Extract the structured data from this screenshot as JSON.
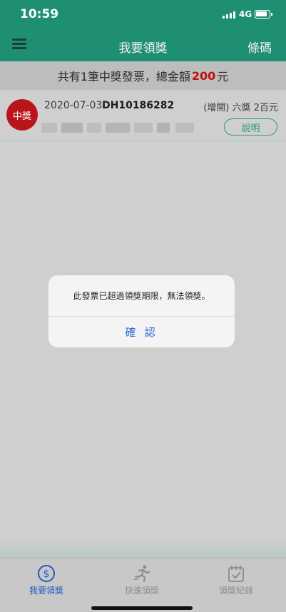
{
  "status_bar": {
    "time": "10:59",
    "network": "4G"
  },
  "header": {
    "title": "我要領獎",
    "right_action": "條碼"
  },
  "summary": {
    "prefix": "共有1筆中獎發票，總金額",
    "amount": "200",
    "suffix": "元"
  },
  "invoice": {
    "badge": "中獎",
    "date": "2020-07-03",
    "number": "DH10186282",
    "prize": "(增開) 六獎 2百元",
    "explain_button": "說明"
  },
  "dialog": {
    "message": "此發票已超過領獎期限，無法領獎。",
    "confirm": "確 認"
  },
  "tabs": [
    {
      "label": "我要領獎",
      "icon": "dollar-circle-icon",
      "active": true
    },
    {
      "label": "快速領獎",
      "icon": "running-person-icon",
      "active": false
    },
    {
      "label": "領獎紀錄",
      "icon": "calendar-check-icon",
      "active": false
    }
  ],
  "colors": {
    "primary": "#1f8f73",
    "accent_red": "#c01010",
    "link_blue": "#2e6bd8",
    "tab_active": "#1f5bc4"
  }
}
